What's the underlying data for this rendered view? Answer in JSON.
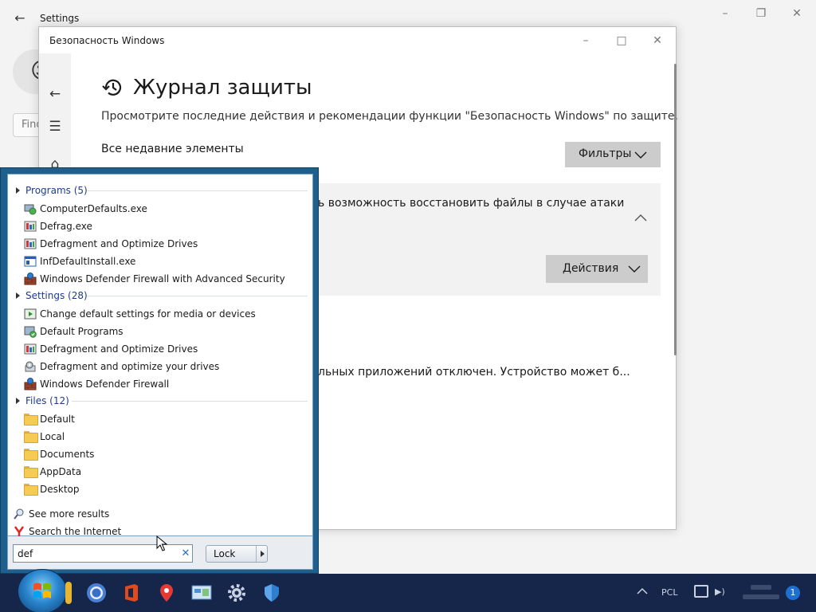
{
  "settings_window": {
    "title": "Settings",
    "find_placeholder": "Find"
  },
  "security_window": {
    "title": "Безопасность Windows",
    "heading": "Журнал защиты",
    "description": "Просмотрите последние действия и рекомендации функции \"Безопасность Windows\" по защите.",
    "recent_label": "Все недавние элементы",
    "filters_label": "Фильтры",
    "card_text": "ь возможность восстановить файлы в случае атаки",
    "actions_label": "Действия",
    "entry_text": "льных приложений отключен. Устройство может б..."
  },
  "start_menu": {
    "groups": [
      {
        "header": "Programs (5)",
        "items": [
          {
            "label": "ComputerDefaults.exe",
            "icon": "computer-defaults-icon"
          },
          {
            "label": "Defrag.exe",
            "icon": "defrag-icon"
          },
          {
            "label": "Defragment and Optimize Drives",
            "icon": "defrag-icon"
          },
          {
            "label": "InfDefaultInstall.exe",
            "icon": "installer-icon"
          },
          {
            "label": "Windows Defender Firewall with Advanced Security",
            "icon": "firewall-icon"
          }
        ]
      },
      {
        "header": "Settings (28)",
        "items": [
          {
            "label": "Change default settings for media or devices",
            "icon": "autoplay-icon"
          },
          {
            "label": "Default Programs",
            "icon": "default-programs-icon"
          },
          {
            "label": "Defragment and Optimize Drives",
            "icon": "defrag-icon"
          },
          {
            "label": "Defragment and optimize your drives",
            "icon": "defrag-settings-icon"
          },
          {
            "label": "Windows Defender Firewall",
            "icon": "firewall-icon"
          }
        ]
      },
      {
        "header": "Files (12)",
        "items": [
          {
            "label": "Default",
            "icon": "folder-icon"
          },
          {
            "label": "Local",
            "icon": "folder-icon"
          },
          {
            "label": "Documents",
            "icon": "folder-icon"
          },
          {
            "label": "AppData",
            "icon": "folder-icon"
          },
          {
            "label": "Desktop",
            "icon": "folder-icon"
          }
        ]
      }
    ],
    "see_more": "See more results",
    "search_internet": "Search the Internet",
    "search_value": "def",
    "lock_label": "Lock"
  },
  "taskbar": {
    "tray_lang": "PCL",
    "notification_count": "1"
  },
  "colors": {
    "start_menu_frame": "#1f5f8e",
    "group_header": "#1e3c8a",
    "taskbar": "#16264a",
    "button_gray": "#cccccc"
  }
}
